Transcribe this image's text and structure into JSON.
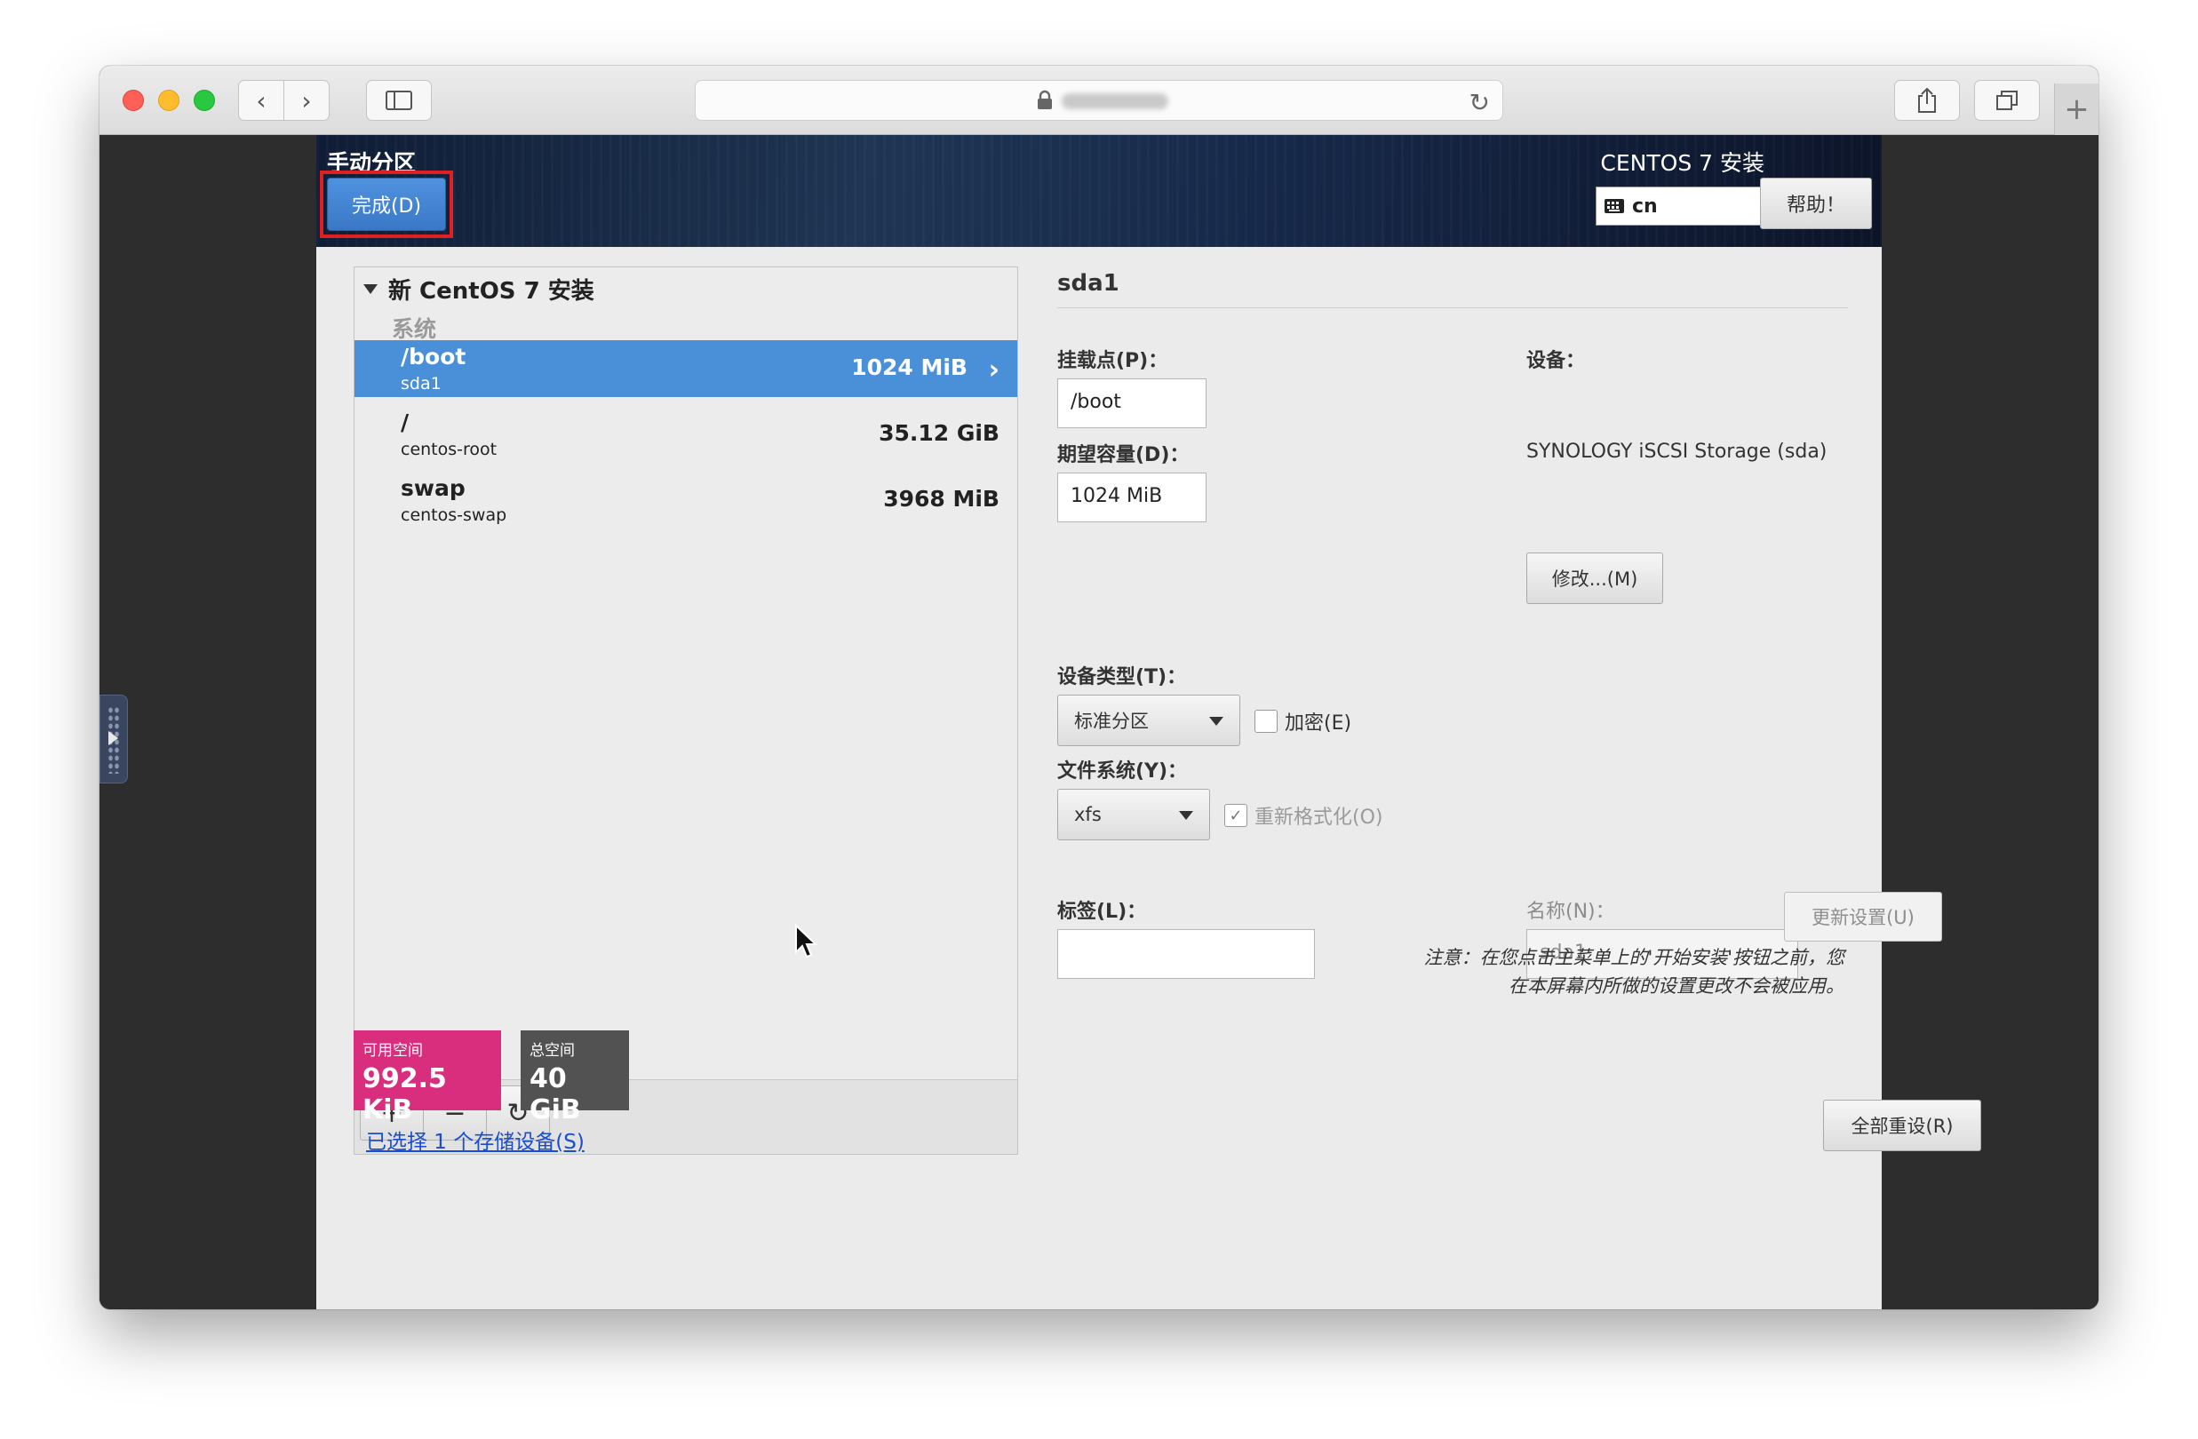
{
  "browser": {
    "nav_back_icon": "‹",
    "nav_forward_icon": "›",
    "reload_icon": "↻",
    "new_tab_icon": "+"
  },
  "header": {
    "spoke_title": "手动分区",
    "done_label": "完成(D)",
    "product_title": "CENTOS 7 安装",
    "keyboard_layout": "cn",
    "help_label": "帮助！"
  },
  "partitions": {
    "install_title": "新 CentOS 7 安装",
    "section_label": "系统",
    "items": [
      {
        "mount": "/boot",
        "device": "sda1",
        "size": "1024 MiB",
        "selected": true
      },
      {
        "mount": "/",
        "device": "centos-root",
        "size": "35.12 GiB",
        "selected": false
      },
      {
        "mount": "swap",
        "device": "centos-swap",
        "size": "3968 MiB",
        "selected": false
      }
    ],
    "toolbar": {
      "add": "+",
      "remove": "−",
      "refresh": "↻"
    }
  },
  "space": {
    "available_label": "可用空间",
    "available_value": "992.5 KiB",
    "total_label": "总空间",
    "total_value": "40 GiB",
    "colors": {
      "available": "#d92d7e",
      "total": "#525252"
    }
  },
  "storage_link": "已选择 1 个存储设备(S)",
  "detail": {
    "title": "sda1",
    "mount_point_label": "挂载点(P)：",
    "mount_point_value": "/boot",
    "capacity_label": "期望容量(D)：",
    "capacity_value": "1024 MiB",
    "device_label": "设备：",
    "device_name": "SYNOLOGY iSCSI Storage (sda)",
    "modify_label": "修改...(M)",
    "device_type_label": "设备类型(T)：",
    "device_type_value": "标准分区",
    "encrypt_label": "加密(E)",
    "encrypt_checked": false,
    "filesystem_label": "文件系统(Y)：",
    "filesystem_value": "xfs",
    "reformat_label": "重新格式化(O)",
    "reformat_checked": true,
    "tag_label": "标签(L)：",
    "tag_value": "",
    "name_label": "名称(N)：",
    "name_value": "sda1",
    "update_label": "更新设置(U)",
    "note_line1": "注意：在您点击主菜单上的'开始安装'按钮之前，您",
    "note_line2": "在本屏幕内所做的设置更改不会被应用。",
    "reset_label": "全部重设(R)"
  },
  "accent_color": "#4a90d9"
}
